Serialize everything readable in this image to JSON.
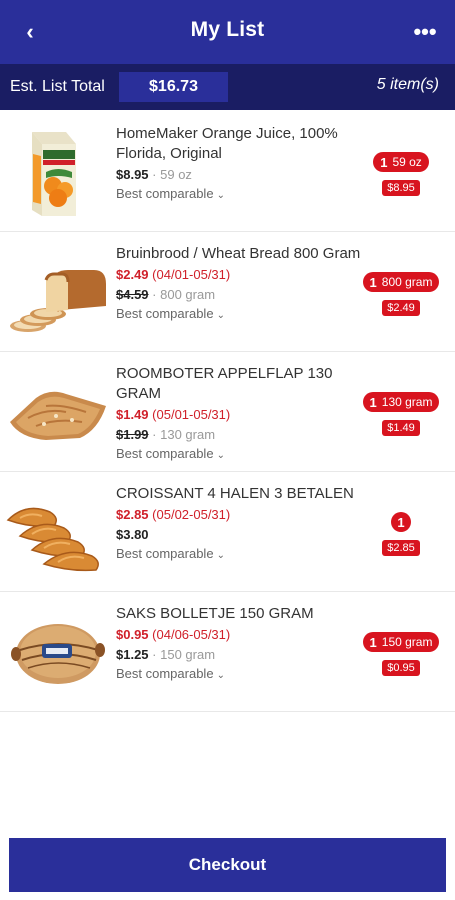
{
  "header": {
    "back_icon": "chevron-left-icon",
    "title": "My List",
    "more_icon": "more-dots-icon"
  },
  "total": {
    "label": "Est. List Total",
    "amount": "$16.73",
    "count": "5 item(s)"
  },
  "items": [
    {
      "name": "HomeMaker Orange Juice, 100% Florida, Original",
      "price": "$8.95",
      "size": "59 oz",
      "comparable": "Best comparable",
      "qty": "1",
      "qty_unit": "59 oz",
      "line_total": "$8.95",
      "image": "orange-juice-carton"
    },
    {
      "name": "Bruinbrood / Wheat Bread 800 Gram",
      "sale_price": "$2.49",
      "sale_dates": "(04/01-05/31)",
      "regular_price": "$4.59",
      "size": "800 gram",
      "comparable": "Best comparable",
      "qty": "1",
      "qty_unit": "800 gram",
      "line_total": "$2.49",
      "image": "wheat-bread"
    },
    {
      "name": "ROOMBOTER APPELFLAP 130 GRAM",
      "sale_price": "$1.49",
      "sale_dates": "(05/01-05/31)",
      "regular_price": "$1.99",
      "size": "130 gram",
      "comparable": "Best comparable",
      "qty": "1",
      "qty_unit": "130 gram",
      "line_total": "$1.49",
      "image": "apple-turnover"
    },
    {
      "name": "CROISSANT 4 HALEN 3 BETALEN",
      "sale_price": "$2.85",
      "sale_dates": "(05/02-05/31)",
      "regular_price": "$3.80",
      "comparable": "Best comparable",
      "qty": "1",
      "line_total": "$2.85",
      "image": "croissants"
    },
    {
      "name": "SAKS BOLLETJE 150 GRAM",
      "sale_price": "$0.95",
      "sale_dates": "(04/06-05/31)",
      "regular_price": "$1.25",
      "size": "150 gram",
      "comparable": "Best comparable",
      "qty": "1",
      "qty_unit": "150 gram",
      "line_total": "$0.95",
      "image": "bread-roll-bag"
    }
  ],
  "checkout": {
    "label": "Checkout"
  },
  "colors": {
    "brand": "#2a2f9a",
    "brand_dark": "#1a1d63",
    "sale_red": "#d0202a",
    "badge_red": "#d8141f"
  }
}
